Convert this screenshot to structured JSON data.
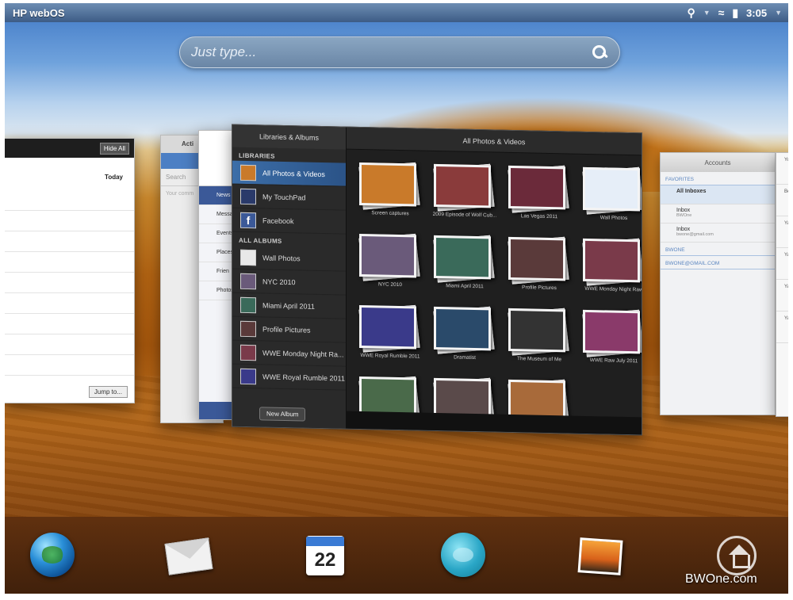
{
  "statusbar": {
    "brand": "HP webOS",
    "time": "3:05"
  },
  "search": {
    "placeholder": "Just type..."
  },
  "left_card": {
    "hide_all": "Hide All",
    "today": "Today",
    "jump": "Jump to..."
  },
  "grey_card": {
    "title": "Acti",
    "search": "Search",
    "note": "Your comm"
  },
  "fb_card": {
    "items": [
      "News",
      "Messag",
      "Events",
      "Places",
      "Frien",
      "Photos"
    ]
  },
  "photos": {
    "sidebar_title": "Libraries & Albums",
    "libraries_heading": "LIBRARIES",
    "libraries": [
      "All Photos & Videos",
      "My TouchPad",
      "Facebook"
    ],
    "albums_heading": "ALL ALBUMS",
    "albums": [
      "Wall Photos",
      "NYC 2010",
      "Miami April 2011",
      "Profile Pictures",
      "WWE Monday Night Ra...",
      "WWE Royal Rumble 2011"
    ],
    "new_album": "New Album",
    "main_title": "All Photos & Videos",
    "grid": [
      {
        "caption": "Screen captures",
        "color": "#c97a2a"
      },
      {
        "caption": "2009 Episode of Wolf Cub...",
        "color": "#8a3b3b"
      },
      {
        "caption": "Las Vegas 2011",
        "color": "#6b2a3a"
      },
      {
        "caption": "Wall Photos",
        "color": "#e6eef8"
      },
      {
        "caption": "NYC 2010",
        "color": "#6a5a7a"
      },
      {
        "caption": "Miami April 2011",
        "color": "#3a6a5a"
      },
      {
        "caption": "Profile Pictures",
        "color": "#5a3a3a"
      },
      {
        "caption": "WWE Monday Night Raw",
        "color": "#7a3a4a"
      },
      {
        "caption": "WWE Royal Rumble 2011",
        "color": "#3a3a8a"
      },
      {
        "caption": "Dramatist",
        "color": "#2a4a6a"
      },
      {
        "caption": "The Museum of Me",
        "color": "#333333"
      },
      {
        "caption": "WWE Raw July 2011",
        "color": "#8a3a6a"
      },
      {
        "caption": "",
        "color": "#4a6a4a"
      },
      {
        "caption": "",
        "color": "#5a4a4a"
      },
      {
        "caption": "",
        "color": "#a86a3a"
      }
    ]
  },
  "email_card": {
    "title": "Accounts",
    "favorites": "FAVORITES",
    "all_inboxes": "All Inboxes",
    "inbox1": "Inbox",
    "inbox1_sub": "BWOne",
    "inbox2": "Inbox",
    "inbox2_sub": "bwone@gmail.com",
    "group2": "BWONE",
    "group3": "BWONE@GMAIL.COM"
  },
  "edge_card": {
    "items": [
      "Yo",
      "Be",
      "Ya",
      "Ya",
      "Ya",
      "Ya"
    ]
  },
  "dock": {
    "icons": [
      "web-browser",
      "email",
      "calendar",
      "messaging",
      "photos",
      "launcher"
    ],
    "calendar_day": "22",
    "watermark": "BWOne.com"
  }
}
